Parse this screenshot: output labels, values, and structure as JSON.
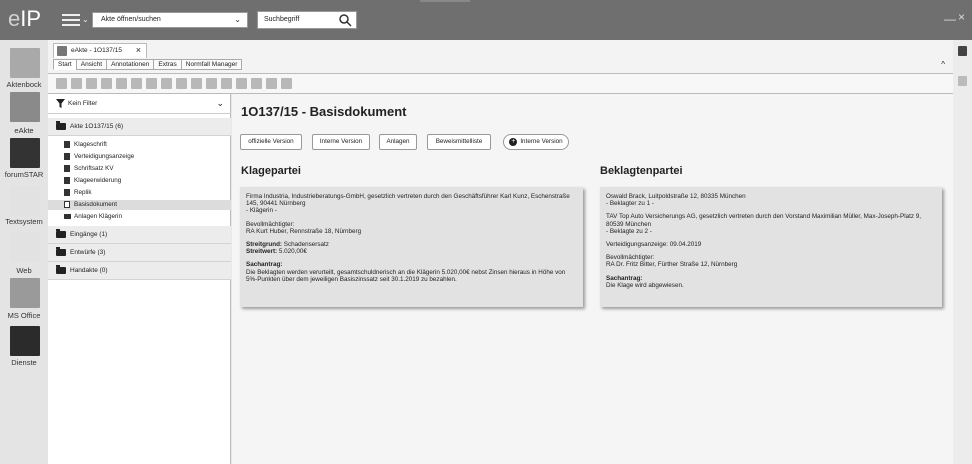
{
  "header": {
    "logo_e": "e",
    "logo_ip": "IP",
    "akte_select_value": "Akte öffnen/suchen",
    "search_placeholder": "Suchbegriff",
    "minimize": "—",
    "close": "×"
  },
  "apps": [
    {
      "label": "Aktenbock"
    },
    {
      "label": "eAkte"
    },
    {
      "label": "forumSTAR"
    },
    {
      "label": "Textsystem"
    },
    {
      "label": "Web"
    },
    {
      "label": "MS Office"
    },
    {
      "label": "Dienste"
    }
  ],
  "document_tab": {
    "label": "eAkte - 1O137/15",
    "close": "×"
  },
  "ribbon_tabs": [
    "Start",
    "Ansicht",
    "Annotationen",
    "Extras",
    "Normfall Manager"
  ],
  "collapse": "^",
  "tree": {
    "filter": "Kein Filter",
    "nodes": {
      "akte": "Akte 1O137/15 (6)",
      "eingaenge": "Eingänge (1)",
      "entwuerfe": "Entwürfe (3)",
      "handakte": "Handakte (0)"
    },
    "leaves": [
      "Klageschrift",
      "Verteidigungsanzeige",
      "Schriftsatz KV",
      "Klageerwiderung",
      "Replik",
      "Basisdokument",
      "Anlagen Klägerin"
    ]
  },
  "main": {
    "title": "1O137/15 - Basisdokument",
    "buttons": {
      "official": "offizielle Version",
      "internal": "Interne Version",
      "attachments": "Anlagen",
      "evidence": "Beweismittelliste",
      "new_internal": "Interne Version"
    },
    "klagepartei": {
      "heading": "Klagepartei",
      "party": "Firma Industria, Industrieberatungs-GmbH, gesetzlich vertreten durch den Geschäftsführer Karl Kunz, Eschenstraße 145, 90441 Nürnberg",
      "role": "- Klägerin -",
      "counsel_label": "Bevollmächtigter:",
      "counsel": "RA Kurt Huber, Rennstraße 18, Nürnberg",
      "streitgrund_label": "Streitgrund:",
      "streitgrund": "Schadensersatz",
      "streitwert_label": "Streitwert:",
      "streitwert": "5.020,00€",
      "antrag_label": "Sachantrag:",
      "antrag": "Die Beklagten werden verurteilt, gesamtschuldnerisch an die Klägerin 5.020,00€ nebst Zinsen hieraus in Höhe von 5%-Punkten über dem jeweiligen Basiszinssatz seit 30.1.2019 zu bezahlen."
    },
    "beklagtenpartei": {
      "heading": "Beklagtenpartei",
      "party1": "Oswald Brack, Luitpoldstraße 12, 80335 München",
      "role1": "- Beklagter zu 1 -",
      "party2": "TAV Top Auto Versicherungs AG, gesetzlich vertreten durch den Vorstand Maximilian Müller, Max-Joseph-Platz 9, 80539 München",
      "role2": "- Beklagte zu 2 -",
      "anzeige": "Verteidigungsanzeige: 09.04.2019",
      "counsel_label": "Bevollmächtigter:",
      "counsel": "RA Dr. Fritz Bitter, Fürther Straße 12, Nürnberg",
      "antrag_label": "Sachantrag:",
      "antrag": "Die Klage wird abgewiesen."
    }
  },
  "colors": {
    "topbar": "#6f6f6f",
    "app_icon": "#a9a9a9",
    "app_icon_active": "#333333"
  }
}
